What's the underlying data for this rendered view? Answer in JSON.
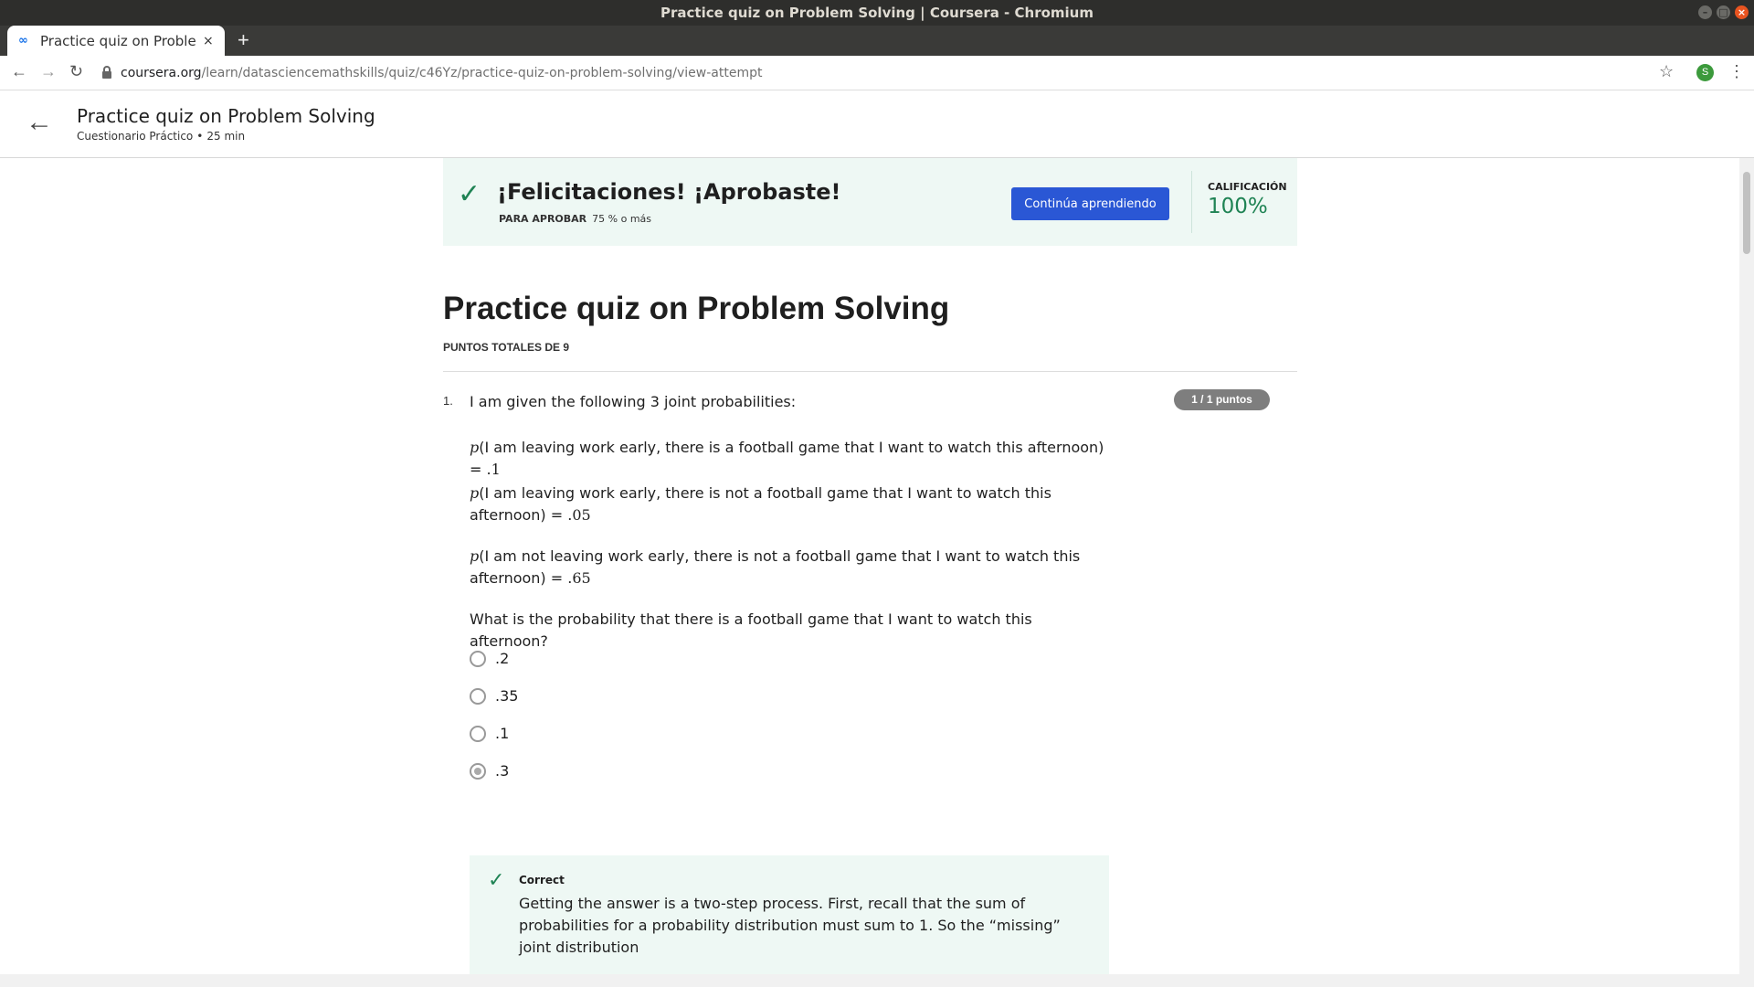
{
  "window": {
    "title": "Practice quiz on Problem Solving | Coursera - Chromium"
  },
  "tab": {
    "title": "Practice quiz on Problem Solving | Coursera",
    "favicon": "coursera-icon",
    "close": "×"
  },
  "newtab": "+",
  "url": {
    "domain": "coursera.org",
    "path": "/learn/datasciencemathskills/quiz/c46Yz/practice-quiz-on-problem-solving/view-attempt"
  },
  "profile_initial": "S",
  "header": {
    "title": "Practice quiz on Problem Solving",
    "type": "Cuestionario Práctico",
    "sep": "•",
    "duration": "25 min"
  },
  "result": {
    "heading": "¡Felicitaciones! ¡Aprobaste!",
    "pass_label": "PARA APROBAR",
    "pass_value": "75 % o más",
    "continue_button": "Continúa aprendiendo",
    "grade_label": "CALIFICACIÓN",
    "grade_value": "100%"
  },
  "quiz": {
    "title": "Practice quiz on Problem Solving",
    "total_points": "PUNTOS TOTALES DE 9"
  },
  "question": {
    "number": "1.",
    "points_badge": "1 / 1 puntos",
    "intro": "I am given the following 3 joint probabilities:",
    "p_symbol": "p",
    "statements": [
      {
        "text": "(I am leaving work early, there is a football game that I want to watch this afternoon) = ",
        "value": ".1"
      },
      {
        "text": "(I am leaving work early, there is not a football game that I want to watch this afternoon) = ",
        "value": ".05"
      },
      {
        "text": "(I am not leaving work early, there is not a football game that I want to watch this afternoon) = ",
        "value": ".65"
      }
    ],
    "prompt": "What is the probability that there is a football game that I want to watch this afternoon?",
    "options": [
      {
        "label": ".2",
        "selected": false
      },
      {
        "label": ".35",
        "selected": false
      },
      {
        "label": ".1",
        "selected": false
      },
      {
        "label": ".3",
        "selected": true
      }
    ],
    "feedback": {
      "label": "Correct",
      "text": "Getting the answer is a two-step process. First, recall that the sum of probabilities for a probability distribution must sum to 1. So the “missing” joint distribution"
    }
  }
}
